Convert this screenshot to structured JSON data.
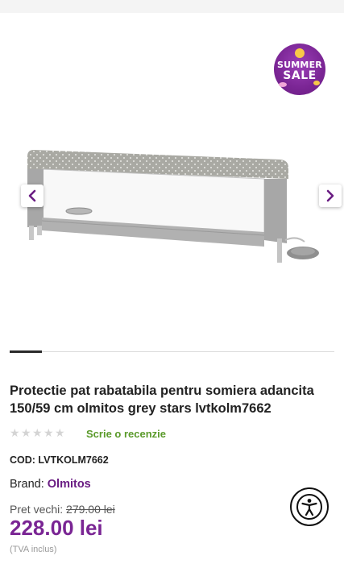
{
  "product": {
    "title": "Protectie pat rabatabila pentru somiera adancita 150/59 cm olmitos grey stars lvtkolm7662",
    "rating_stars": 5,
    "review_link": "Scrie o recenzie",
    "code": "COD: LVTKOLM7662",
    "brand_label": "Brand:",
    "brand_name": "Olmitos",
    "old_price_label": "Pret vechi:",
    "old_price": "279.00 lei",
    "price": "228.00 lei",
    "tva_note": "(TVA inclus)"
  },
  "badge": {
    "line1": "SUMMER",
    "line2": "SALE"
  },
  "gallery": {
    "prev_icon": "chevron-left-icon",
    "next_icon": "chevron-right-icon",
    "active_slide": 1
  },
  "colors": {
    "accent_purple": "#7a2594",
    "review_green": "#5a9a2a"
  },
  "accessibility": {
    "icon": "accessibility-icon"
  }
}
